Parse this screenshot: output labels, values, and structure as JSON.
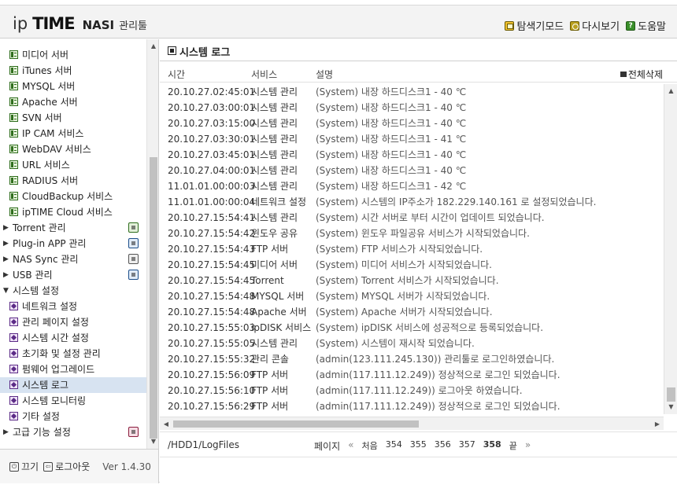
{
  "header": {
    "logo_ip": "ip",
    "logo_time": "TIME",
    "logo_nas": "NASI",
    "logo_sub": "관리툴",
    "links": [
      {
        "label": "탐색기모드",
        "icon": "explorer-icon"
      },
      {
        "label": "다시보기",
        "icon": "refresh-icon"
      },
      {
        "label": "도움말",
        "icon": "help-icon"
      }
    ]
  },
  "sidebar": {
    "items": [
      {
        "label": "미디어 서버",
        "icon": "service-icon",
        "type": "child"
      },
      {
        "label": "iTunes 서버",
        "icon": "service-icon",
        "type": "child"
      },
      {
        "label": "MYSQL 서버",
        "icon": "service-icon",
        "type": "child"
      },
      {
        "label": "Apache 서버",
        "icon": "service-icon",
        "type": "child"
      },
      {
        "label": "SVN 서버",
        "icon": "service-icon",
        "type": "child"
      },
      {
        "label": "IP CAM 서비스",
        "icon": "service-icon",
        "type": "child"
      },
      {
        "label": "WebDAV 서비스",
        "icon": "service-icon",
        "type": "child"
      },
      {
        "label": "URL 서비스",
        "icon": "service-icon",
        "type": "child"
      },
      {
        "label": "RADIUS 서버",
        "icon": "service-icon",
        "type": "child"
      },
      {
        "label": "CloudBackup 서비스",
        "icon": "service-icon",
        "type": "child"
      },
      {
        "label": "ipTIME Cloud 서비스",
        "icon": "service-icon",
        "type": "child"
      },
      {
        "label": "Torrent 관리",
        "icon": "torrent-icon",
        "type": "group",
        "expanded": false
      },
      {
        "label": "Plug-in APP 관리",
        "icon": "plugin-icon",
        "type": "group",
        "expanded": false
      },
      {
        "label": "NAS Sync 관리",
        "icon": "sync-icon",
        "type": "group",
        "expanded": false
      },
      {
        "label": "USB 관리",
        "icon": "usb-icon",
        "type": "group",
        "expanded": false
      },
      {
        "label": "시스템 설정",
        "icon": "",
        "type": "group",
        "expanded": true
      },
      {
        "label": "네트워크 설정",
        "icon": "settings-icon",
        "type": "child"
      },
      {
        "label": "관리 페이지 설정",
        "icon": "settings-icon",
        "type": "child"
      },
      {
        "label": "시스템 시간 설정",
        "icon": "settings-icon",
        "type": "child"
      },
      {
        "label": "초기화 및 설정 관리",
        "icon": "settings-icon",
        "type": "child"
      },
      {
        "label": "펌웨어 업그레이드",
        "icon": "settings-icon",
        "type": "child"
      },
      {
        "label": "시스템 로그",
        "icon": "settings-icon",
        "type": "child",
        "selected": true
      },
      {
        "label": "시스템 모니터링",
        "icon": "settings-icon",
        "type": "child"
      },
      {
        "label": "기타 설정",
        "icon": "settings-icon",
        "type": "child"
      },
      {
        "label": "고급 기능 설정",
        "icon": "advanced-icon",
        "type": "group",
        "expanded": false
      }
    ]
  },
  "footer": {
    "power_label": "끄기",
    "logout_label": "로그아웃",
    "version": "Ver 1.4.30"
  },
  "main": {
    "title": "시스템 로그",
    "columns": {
      "time": "시간",
      "service": "서비스",
      "desc": "설명"
    },
    "delete_all": "전체삭제",
    "rows": [
      {
        "time": "20.10.27.02:45:01",
        "service": "시스템 관리",
        "desc": "(System) 내장 하드디스크1 - 40 ℃"
      },
      {
        "time": "20.10.27.03:00:01",
        "service": "시스템 관리",
        "desc": "(System) 내장 하드디스크1 - 40 ℃"
      },
      {
        "time": "20.10.27.03:15:00",
        "service": "시스템 관리",
        "desc": "(System) 내장 하드디스크1 - 40 ℃"
      },
      {
        "time": "20.10.27.03:30:01",
        "service": "시스템 관리",
        "desc": "(System) 내장 하드디스크1 - 41 ℃"
      },
      {
        "time": "20.10.27.03:45:01",
        "service": "시스템 관리",
        "desc": "(System) 내장 하드디스크1 - 40 ℃"
      },
      {
        "time": "20.10.27.04:00:01",
        "service": "시스템 관리",
        "desc": "(System) 내장 하드디스크1 - 40 ℃"
      },
      {
        "time": "11.01.01.00:00:03",
        "service": "시스템 관리",
        "desc": "(System) 내장 하드디스크1 - 42 ℃"
      },
      {
        "time": "11.01.01.00:00:04",
        "service": "네트워크 설정",
        "desc": "(System) 시스템의 IP주소가 182.229.140.161 로 설정되었습니다."
      },
      {
        "time": "20.10.27.15:54:41",
        "service": "시스템 관리",
        "desc": "(System) 시간 서버로 부터 시간이 업데이트 되었습니다."
      },
      {
        "time": "20.10.27.15:54:42",
        "service": "윈도우 공유",
        "desc": "(System) 윈도우 파일공유 서비스가 시작되었습니다."
      },
      {
        "time": "20.10.27.15:54:43",
        "service": "FTP 서버",
        "desc": "(System) FTP 서비스가 시작되었습니다."
      },
      {
        "time": "20.10.27.15:54:45",
        "service": "미디어 서버",
        "desc": "(System) 미디어 서비스가 시작되었습니다."
      },
      {
        "time": "20.10.27.15:54:45",
        "service": "Torrent",
        "desc": "(System) Torrent 서비스가 시작되었습니다."
      },
      {
        "time": "20.10.27.15:54:48",
        "service": "MYSQL 서버",
        "desc": "(System) MYSQL 서버가 시작되었습니다."
      },
      {
        "time": "20.10.27.15:54:48",
        "service": "Apache 서버",
        "desc": "(System) Apache 서버가 시작되었습니다."
      },
      {
        "time": "20.10.27.15:55:03",
        "service": "ipDISK 서비스",
        "desc": "(System) ipDISK 서비스에 성공적으로 등록되었습니다."
      },
      {
        "time": "20.10.27.15:55:05",
        "service": "시스템 관리",
        "desc": "(System) 시스템이 재시작 되었습니다."
      },
      {
        "time": "20.10.27.15:55:32",
        "service": "관리 콘솔",
        "desc": "(admin(123.111.245.130)) 관리툴로 로그인하였습니다."
      },
      {
        "time": "20.10.27.15:56:09",
        "service": "FTP 서버",
        "desc": "(admin(117.111.12.249)) 정상적으로 로그인 되었습니다."
      },
      {
        "time": "20.10.27.15:56:10",
        "service": "FTP 서버",
        "desc": "(admin(117.111.12.249)) 로그아웃 하였습니다."
      },
      {
        "time": "20.10.27.15:56:29",
        "service": "FTP 서버",
        "desc": "(admin(117.111.12.249)) 정상적으로 로그인 되었습니다."
      }
    ],
    "path": "/HDD1/LogFiles",
    "pager": {
      "page_label": "페이지",
      "prev": "«",
      "first": "처음",
      "pages": [
        "354",
        "355",
        "356",
        "357",
        "358"
      ],
      "current": "358",
      "last": "끝",
      "next": "»"
    }
  }
}
